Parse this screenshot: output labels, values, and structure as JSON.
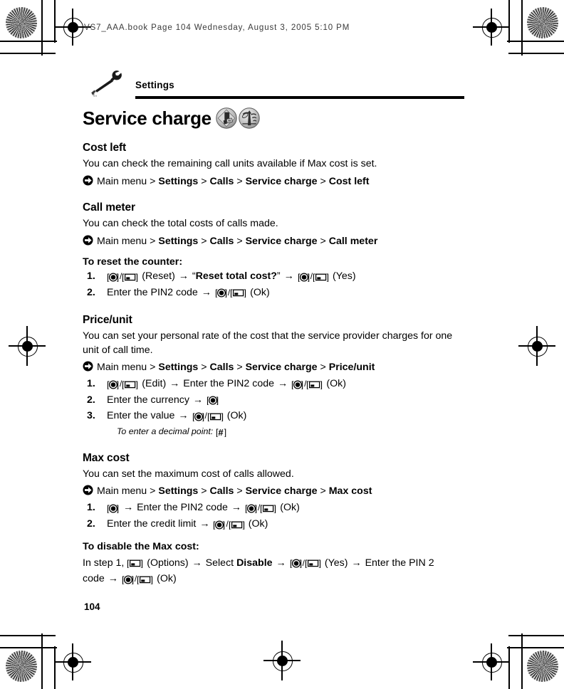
{
  "print_header": "VS7_AAA.book  Page 104  Wednesday, August 3, 2005  5:10 PM",
  "running_head": {
    "icon": "wrench-icon",
    "title": "Settings"
  },
  "chapter": {
    "title": "Service charge",
    "badges": [
      "sim-card-icon",
      "network-antenna-icon"
    ]
  },
  "page_number": "104",
  "symbols": {
    "nav_arrow": "circled-right-arrow",
    "right_arrow": "→",
    "center_key": "[◉]",
    "soft_key": "[▫]",
    "hash_key": "[#]",
    "separator": "/",
    "breadcrumb_sep": ">"
  },
  "sections": [
    {
      "heading": "Cost left",
      "body": "You can check the remaining call units available if Max cost is set.",
      "nav": {
        "root": "Main menu",
        "crumbs": [
          "Settings",
          "Calls",
          "Service charge",
          "Cost left"
        ]
      }
    },
    {
      "heading": "Call meter",
      "body": "You can check the total costs of calls made.",
      "nav": {
        "root": "Main menu",
        "crumbs": [
          "Settings",
          "Calls",
          "Service charge",
          "Call meter"
        ]
      },
      "lead": "To reset the counter:",
      "steps": [
        {
          "num": "1.",
          "parts": [
            {
              "t": "keypair"
            },
            {
              "t": "text",
              "v": " (Reset) "
            },
            {
              "t": "arrow"
            },
            {
              "t": "text",
              "v": " “"
            },
            {
              "t": "bold",
              "v": "Reset total cost?"
            },
            {
              "t": "text",
              "v": "” "
            },
            {
              "t": "arrow"
            },
            {
              "t": "text",
              "v": " "
            },
            {
              "t": "keypair"
            },
            {
              "t": "text",
              "v": " (Yes)"
            }
          ]
        },
        {
          "num": "2.",
          "parts": [
            {
              "t": "text",
              "v": "Enter the PIN2 code "
            },
            {
              "t": "arrow"
            },
            {
              "t": "text",
              "v": " "
            },
            {
              "t": "keypair"
            },
            {
              "t": "text",
              "v": " (Ok)"
            }
          ]
        }
      ]
    },
    {
      "heading": "Price/unit",
      "body": "You can set your personal rate of the cost that the service provider charges for one unit of call time.",
      "nav": {
        "root": "Main menu",
        "crumbs": [
          "Settings",
          "Calls",
          "Service charge",
          "Price/unit"
        ]
      },
      "steps": [
        {
          "num": "1.",
          "parts": [
            {
              "t": "keypair"
            },
            {
              "t": "text",
              "v": " (Edit) "
            },
            {
              "t": "arrow"
            },
            {
              "t": "text",
              "v": " Enter the PIN2 code "
            },
            {
              "t": "arrow"
            },
            {
              "t": "text",
              "v": " "
            },
            {
              "t": "keypair"
            },
            {
              "t": "text",
              "v": " (Ok)"
            }
          ]
        },
        {
          "num": "2.",
          "parts": [
            {
              "t": "text",
              "v": "Enter the currency "
            },
            {
              "t": "arrow"
            },
            {
              "t": "text",
              "v": " "
            },
            {
              "t": "centerkey"
            }
          ]
        },
        {
          "num": "3.",
          "parts": [
            {
              "t": "text",
              "v": "Enter the value "
            },
            {
              "t": "arrow"
            },
            {
              "t": "text",
              "v": " "
            },
            {
              "t": "keypair"
            },
            {
              "t": "text",
              "v": " (Ok)"
            }
          ],
          "note": {
            "label": "To enter a decimal point:",
            "key": "hash"
          }
        }
      ]
    },
    {
      "heading": "Max cost",
      "body": "You can set the maximum cost of calls allowed.",
      "nav": {
        "root": "Main menu",
        "crumbs": [
          "Settings",
          "Calls",
          "Service charge",
          "Max cost"
        ]
      },
      "steps": [
        {
          "num": "1.",
          "parts": [
            {
              "t": "centerkey"
            },
            {
              "t": "text",
              "v": " "
            },
            {
              "t": "arrow"
            },
            {
              "t": "text",
              "v": " Enter the PIN2 code "
            },
            {
              "t": "arrow"
            },
            {
              "t": "text",
              "v": " "
            },
            {
              "t": "keypair"
            },
            {
              "t": "text",
              "v": " (Ok)"
            }
          ]
        },
        {
          "num": "2.",
          "parts": [
            {
              "t": "text",
              "v": "Enter the credit limit "
            },
            {
              "t": "arrow"
            },
            {
              "t": "text",
              "v": " "
            },
            {
              "t": "keypair"
            },
            {
              "t": "text",
              "v": " (Ok)"
            }
          ]
        }
      ],
      "trailer": {
        "heading": "To disable the Max cost:",
        "parts": [
          {
            "t": "text",
            "v": "In step 1, "
          },
          {
            "t": "softkey"
          },
          {
            "t": "text",
            "v": " (Options) "
          },
          {
            "t": "arrow"
          },
          {
            "t": "text",
            "v": " Select "
          },
          {
            "t": "bold",
            "v": "Disable"
          },
          {
            "t": "text",
            "v": " "
          },
          {
            "t": "arrow"
          },
          {
            "t": "text",
            "v": " "
          },
          {
            "t": "keypair"
          },
          {
            "t": "text",
            "v": " (Yes) "
          },
          {
            "t": "arrow"
          },
          {
            "t": "text",
            "v": " Enter the PIN 2 code "
          },
          {
            "t": "arrow"
          },
          {
            "t": "text",
            "v": " "
          },
          {
            "t": "keypair"
          },
          {
            "t": "text",
            "v": " (Ok)"
          }
        ]
      }
    }
  ]
}
